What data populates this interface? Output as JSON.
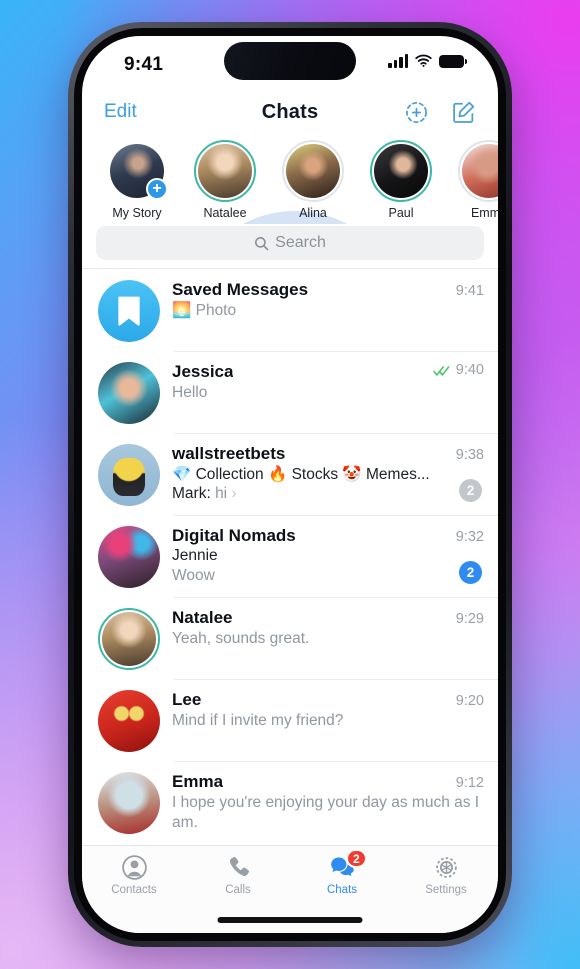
{
  "status_bar": {
    "time": "9:41",
    "icons": {
      "signal": "signal-bars-icon",
      "wifi": "wifi-icon",
      "battery": "battery-icon"
    }
  },
  "nav": {
    "edit_label": "Edit",
    "title": "Chats",
    "new_story_icon": "add-story-icon",
    "compose_icon": "compose-icon"
  },
  "stories": [
    {
      "name": "My Story",
      "ring": "none",
      "photo": "ph-mystory",
      "add_badge": "+"
    },
    {
      "name": "Natalee",
      "ring": "unread",
      "photo": "ph-natalee"
    },
    {
      "name": "Alina",
      "ring": "read",
      "photo": "ph-alina"
    },
    {
      "name": "Paul",
      "ring": "unread",
      "photo": "ph-paul"
    },
    {
      "name": "Emma",
      "ring": "read",
      "photo": "ph-emma"
    }
  ],
  "search": {
    "placeholder": "Search",
    "icon": "search-icon"
  },
  "chats": [
    {
      "title": "Saved Messages",
      "preview": "🌅 Photo",
      "time": "9:41",
      "avatar": "saved",
      "ring": false,
      "ticks": false,
      "badge": null
    },
    {
      "title": "Jessica",
      "preview": "Hello",
      "time": "9:40",
      "avatar": "ph-jessica",
      "ring": false,
      "ticks": true,
      "badge": null
    },
    {
      "title": "wallstreetbets",
      "rich_preview": "💎 Collection 🔥 Stocks 🤡 Memes...",
      "draft_sender": "Mark:",
      "draft_text": "hi",
      "time": "9:38",
      "avatar": "ph-wsb",
      "ring": false,
      "ticks": false,
      "badge": {
        "count": "2",
        "style": "muted"
      }
    },
    {
      "title": "Digital Nomads",
      "sender": "Jennie",
      "preview": "Woow",
      "time": "9:32",
      "avatar": "ph-nomads",
      "ring": false,
      "ticks": false,
      "badge": {
        "count": "2",
        "style": "active"
      }
    },
    {
      "title": "Natalee",
      "preview": "Yeah, sounds great.",
      "time": "9:29",
      "avatar": "ph-natalee",
      "ring": true,
      "ticks": false,
      "badge": null
    },
    {
      "title": "Lee",
      "preview": "Mind if I invite my friend?",
      "time": "9:20",
      "avatar": "ph-lee",
      "ring": false,
      "ticks": false,
      "badge": null
    },
    {
      "title": "Emma",
      "preview": "I hope you're enjoying your day as much as I am.",
      "time": "9:12",
      "avatar": "ph-emma2",
      "ring": false,
      "ticks": false,
      "badge": null
    }
  ],
  "tab_bar": [
    {
      "label": "Contacts",
      "icon": "contacts-icon",
      "active": false,
      "badge": null
    },
    {
      "label": "Calls",
      "icon": "phone-icon",
      "active": false,
      "badge": null
    },
    {
      "label": "Chats",
      "icon": "chats-icon",
      "active": true,
      "badge": "2"
    },
    {
      "label": "Settings",
      "icon": "gear-icon",
      "active": false,
      "badge": null
    }
  ],
  "colors": {
    "accent": "#2f8bef",
    "nav_tint": "#3c9fe0",
    "story_unread_ring": "#3bb9a6",
    "badge_muted": "#c3c7cc",
    "badge_alert": "#f03b30",
    "ticks_read": "#4fc46a"
  },
  "touch_indicator": {
    "target": "Natalee"
  }
}
